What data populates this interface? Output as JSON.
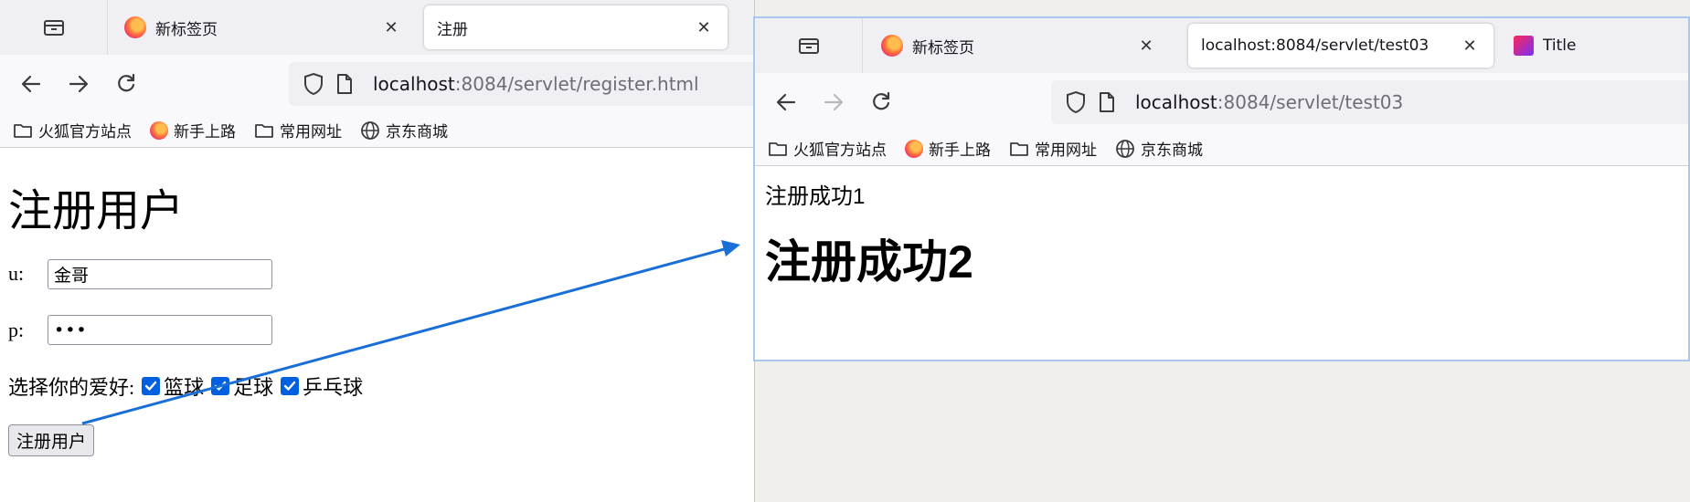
{
  "left_window": {
    "tabs": [
      {
        "label": "新标签页",
        "active": false
      },
      {
        "label": "注册",
        "active": true
      }
    ],
    "url_host": "localhost",
    "url_rest": ":8084/servlet/register.html",
    "bookmarks": [
      "火狐官方站点",
      "新手上路",
      "常用网址",
      "京东商城"
    ],
    "page": {
      "heading": "注册用户",
      "username_label": "u:",
      "username_value": "金哥",
      "password_label": "p:",
      "password_value": "•••",
      "hobby_label": "选择你的爱好:",
      "hobbies": [
        {
          "label": "篮球",
          "checked": true
        },
        {
          "label": "足球",
          "checked": true
        },
        {
          "label": "乒乓球",
          "checked": true
        }
      ],
      "submit_label": "注册用户"
    }
  },
  "right_window": {
    "tabs": [
      {
        "label": "新标签页",
        "active": false
      },
      {
        "label": "localhost:8084/servlet/test03",
        "active": true
      },
      {
        "label": "Title",
        "active": false
      }
    ],
    "url_host": "localhost",
    "url_rest": ":8084/servlet/test03",
    "bookmarks": [
      "火狐官方站点",
      "新手上路",
      "常用网址",
      "京东商城"
    ],
    "page": {
      "line1": "注册成功1",
      "line2": "注册成功2"
    }
  },
  "colors": {
    "accent": "#0060df",
    "arrow": "#1a6fd6",
    "tabbar_bg": "#f0f0f4",
    "toolbar_bg": "#f9f9fb"
  }
}
